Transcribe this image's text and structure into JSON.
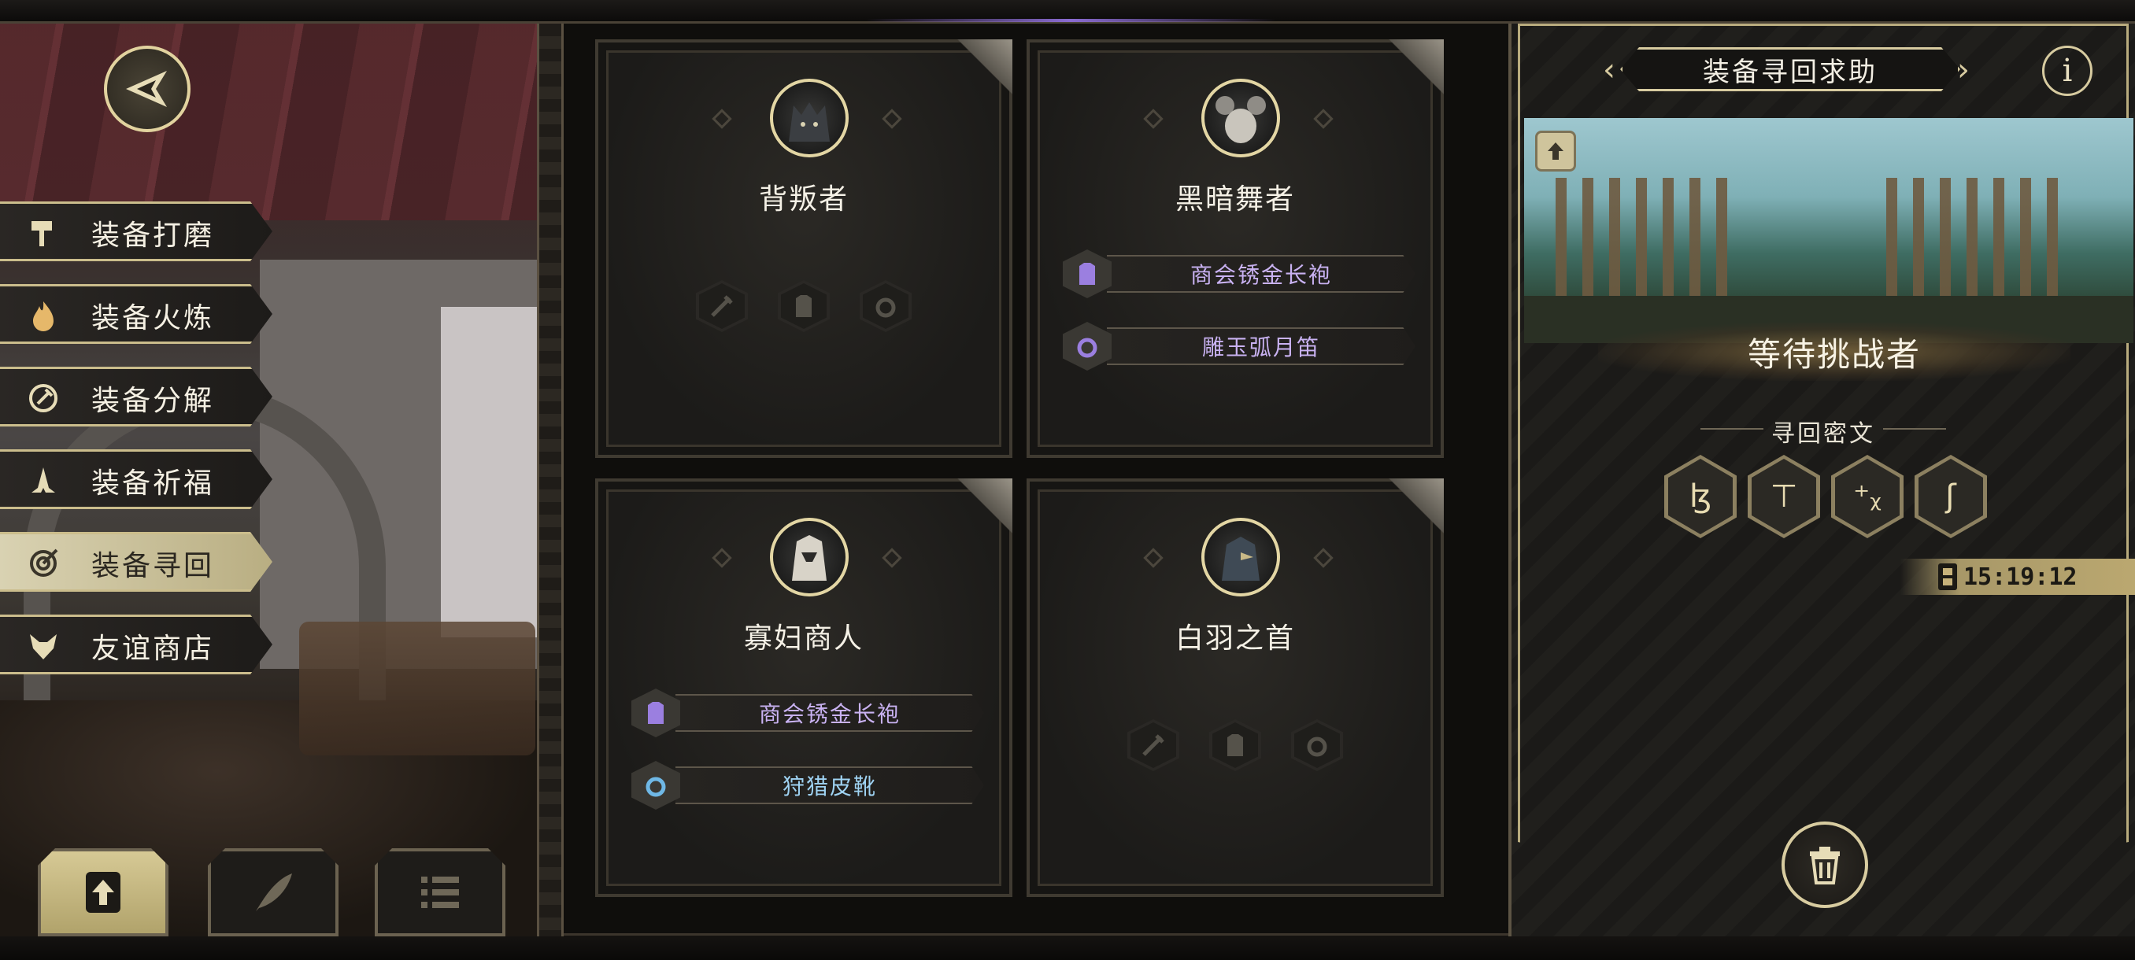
{
  "menu": {
    "items": [
      {
        "label": "装备打磨",
        "icon": "hammer-icon",
        "active": false
      },
      {
        "label": "装备火炼",
        "icon": "flame-icon",
        "active": false
      },
      {
        "label": "装备分解",
        "icon": "dismantle-icon",
        "active": false
      },
      {
        "label": "装备祈福",
        "icon": "pray-icon",
        "active": false
      },
      {
        "label": "装备寻回",
        "icon": "target-icon",
        "active": true
      },
      {
        "label": "友谊商店",
        "icon": "fox-icon",
        "active": false
      }
    ]
  },
  "toolbar": {
    "tools": [
      {
        "icon": "upload-icon",
        "active": true
      },
      {
        "icon": "feather-icon",
        "active": false
      },
      {
        "icon": "list-icon",
        "active": false
      }
    ]
  },
  "cards": [
    {
      "name": "背叛者",
      "portrait": "wolf-portrait",
      "loot": []
    },
    {
      "name": "黑暗舞者",
      "portrait": "mouse-portrait",
      "loot": [
        {
          "label": "商会锈金长袍",
          "icon": "armor-icon",
          "rarity": "purple"
        },
        {
          "label": "雕玉弧月笛",
          "icon": "ring-icon",
          "rarity": "purple"
        }
      ]
    },
    {
      "name": "寡妇商人",
      "portrait": "bird-portrait",
      "loot": [
        {
          "label": "商会锈金长袍",
          "icon": "armor-icon",
          "rarity": "purple"
        },
        {
          "label": "狩猎皮靴",
          "icon": "ring-icon",
          "rarity": "blue"
        }
      ]
    },
    {
      "name": "白羽之首",
      "portrait": "raven-portrait",
      "loot": []
    }
  ],
  "panel": {
    "title": "装备寻回求助",
    "info_icon": "info-icon",
    "status": "等待挑战者",
    "cipher_label": "寻回密文",
    "runes": [
      "ɮ",
      "⊤",
      "⁺ᵪ",
      "ʃ"
    ],
    "timer": "15:19:12",
    "trash_icon": "trash-icon"
  },
  "colors": {
    "accent_gold": "#d7cba0",
    "rarity_purple": "#c9b2f2",
    "rarity_blue": "#9fd3f3"
  }
}
